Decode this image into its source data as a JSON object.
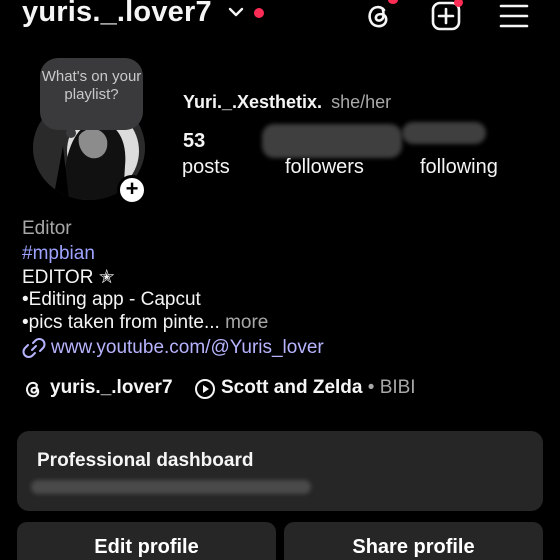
{
  "header": {
    "username": "yuris._.lover7",
    "icons": [
      "chevron-down-icon",
      "threads-icon",
      "create-post-icon",
      "menu-icon"
    ],
    "notification_color": "#ff2d55"
  },
  "profile": {
    "note": "What's on your playlist?",
    "display_name": "Yuri._.Xesthetix.",
    "pronouns": "she/her",
    "posts_count": "53",
    "posts_label": "posts",
    "followers_label": "followers",
    "following_label": "following"
  },
  "bio": {
    "category": "Editor",
    "hashtag": "#mpbian",
    "line1": "EDITOR ✭",
    "line2": "•Editing app - Capcut",
    "line3": "•pics taken from pinte...",
    "more": "more",
    "link": "www.youtube.com/@Yuris_lover"
  },
  "chips": {
    "threads_handle": "yuris._.lover7",
    "music_title": "Scott and Zelda",
    "music_separator": "•",
    "music_artist": "BIBI"
  },
  "dashboard": {
    "title": "Professional dashboard"
  },
  "actions": {
    "edit": "Edit profile",
    "share": "Share profile"
  },
  "colors": {
    "background": "#000000",
    "surface": "#262626",
    "link": "#b7b4ff",
    "hashtag": "#9ea3ff"
  }
}
